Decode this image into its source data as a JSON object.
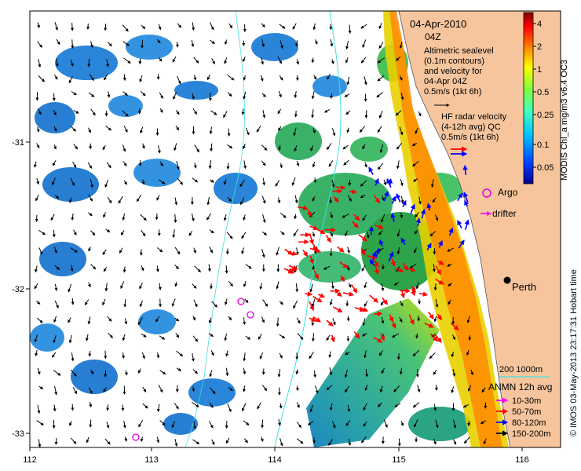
{
  "title": {
    "date": "04-Apr-2010",
    "time": "04Z"
  },
  "altimetry_note": [
    "Altimetric sealevel",
    "(0.1m contours)",
    "and velocity for",
    "04-Apr 04Z",
    "0.5m/s (1kt 6h)"
  ],
  "hf_note": [
    "HF radar velocity",
    "(4-12h avg) QC",
    "0.5m/s (1kt 6h)"
  ],
  "places": {
    "argo": "Argo",
    "drifter": "drifter",
    "perth": "Perth"
  },
  "scale_bar": "200  1000m",
  "anmn": {
    "title": "ANMN 12h avg",
    "items": [
      {
        "label": "10-30m",
        "color": "#ff00ff"
      },
      {
        "label": "50-70m",
        "color": "#ff0000"
      },
      {
        "label": "80-120m",
        "color": "#0000ff"
      },
      {
        "label": "150-200m",
        "color": "#000000"
      }
    ]
  },
  "colorbar": {
    "title": "MODIS Chl_a mg/m3 v6.4 OC3",
    "ticks": [
      "4",
      "2",
      "1",
      "0.5",
      "0.25",
      "0.1",
      "0.05"
    ]
  },
  "credit": "© IMOS 03-May-2013 23:17:31 Hobart time",
  "x_ticks": [
    "112",
    "113",
    "114",
    "115",
    "116"
  ],
  "y_ticks": [
    "-31",
    "-32",
    "-33"
  ]
}
